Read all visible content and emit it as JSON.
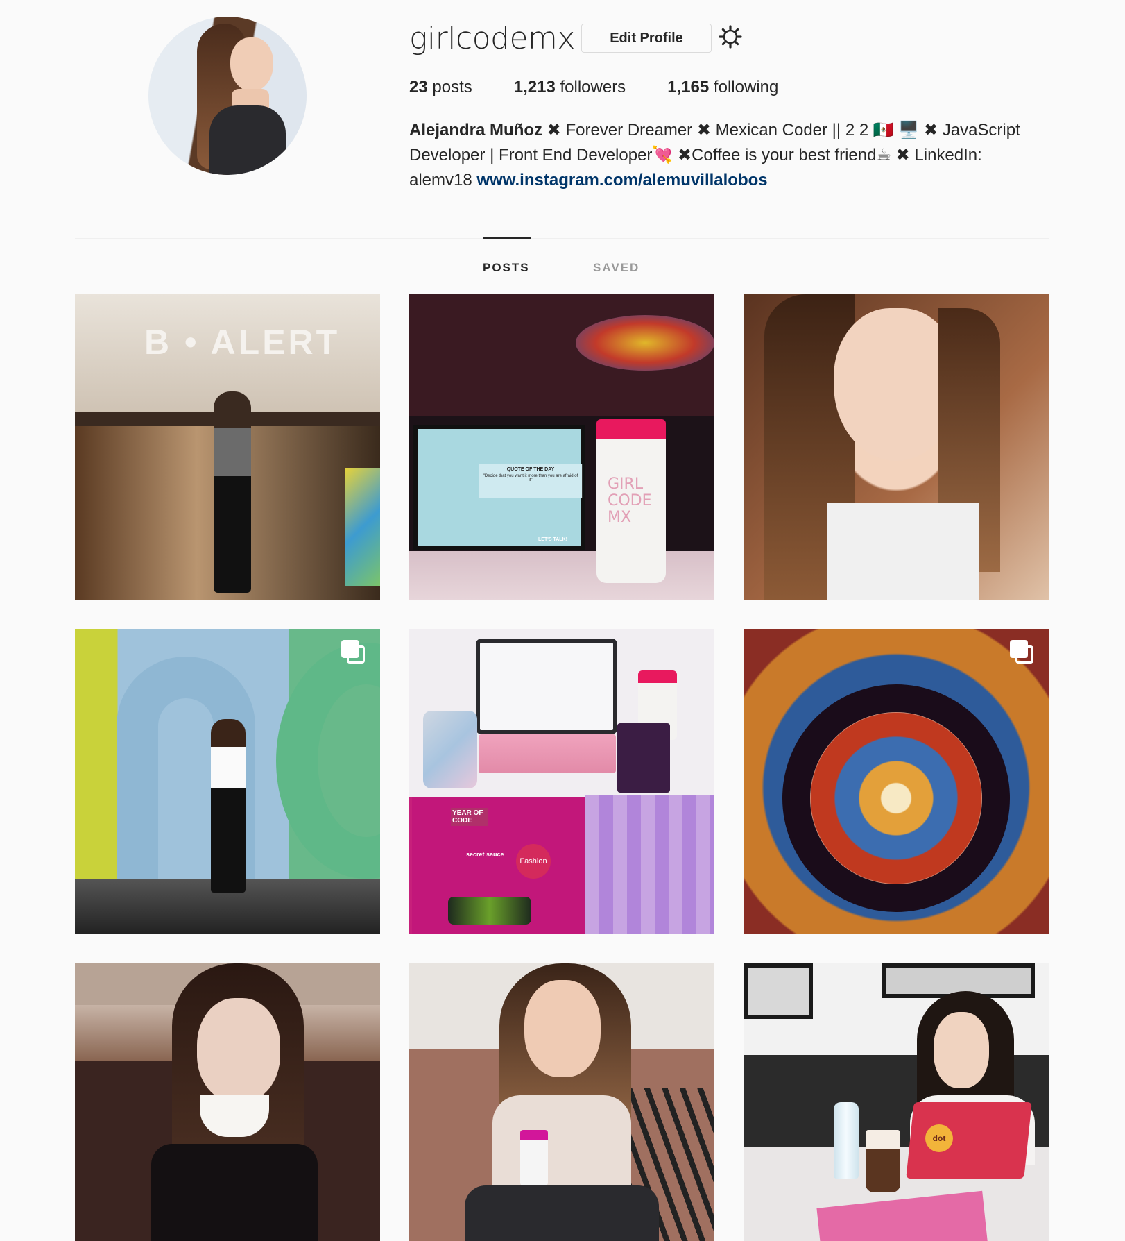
{
  "profile": {
    "username": "girlcodemx",
    "edit_profile_label": "Edit Profile",
    "stats": {
      "posts_count": "23",
      "posts_label": "posts",
      "followers_count": "1,213",
      "followers_label": "followers",
      "following_count": "1,165",
      "following_label": "following"
    },
    "bio": {
      "name": "Alejandra Muñoz",
      "text": " ✖ Forever Dreamer ✖ Mexican Coder || 2 2 🇲🇽 🖥️  ✖ JavaScript Developer | Front End Developer💘  ✖Coffee is your best friend☕  ✖ LinkedIn: alemv18 ",
      "link": "www.instagram.com/alemuvillalobos"
    }
  },
  "tabs": {
    "posts": "POSTS",
    "saved": "SAVED"
  },
  "grid": {
    "tile_texts": {
      "t1_sign": "B • ALERT",
      "t2_cup": "GIRL CODE MX",
      "t2_screen_title": "QUOTE OF THE DAY",
      "t2_screen_quote": "\"Decide that you want it more than you are afraid of it\"",
      "t2_screen_cta": "LET'S TALK!",
      "t5_sticker_1": "YEAR OF CODE",
      "t5_sticker_2": "secret sauce",
      "t5_sticker_3": "Fashion",
      "t9_sticker": "dot"
    },
    "multi_indicators": [
      "tile-4",
      "tile-6"
    ]
  },
  "colors": {
    "link": "#003569",
    "text": "#262626",
    "muted": "#999999",
    "border": "#dbdbdb",
    "background": "#fafafa"
  }
}
